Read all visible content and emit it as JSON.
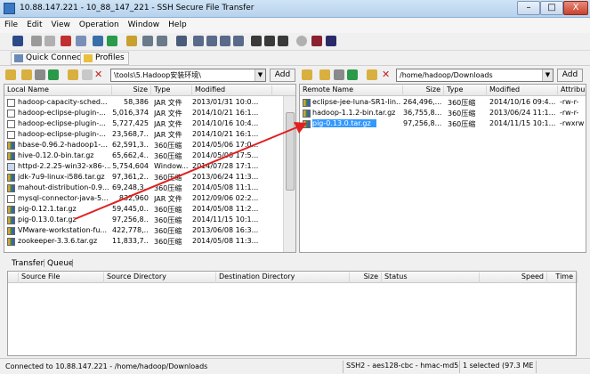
{
  "window": {
    "title": "10.88.147.221 - 10_88_147_221 - SSH Secure File Transfer",
    "minimize": "–",
    "maximize": "□",
    "close": "X"
  },
  "menu": [
    "File",
    "Edit",
    "View",
    "Operation",
    "Window",
    "Help"
  ],
  "toolbar2": {
    "quick_connect": "Quick Connect",
    "profiles": "Profiles"
  },
  "local": {
    "path": "\\tools\\5.Hadoop安装环境\\",
    "add": "Add",
    "columns": [
      "Local Name",
      "Size",
      "Type",
      "Modified"
    ],
    "files": [
      {
        "name": "hadoop-capacity-sched...",
        "size": "58,386",
        "type": "JAR 文件",
        "modified": "2013/01/31 10:0...",
        "icon": "plain"
      },
      {
        "name": "hadoop-eclipse-plugin-...",
        "size": "5,016,374",
        "type": "JAR 文件",
        "modified": "2014/10/21 16:1...",
        "icon": "plain"
      },
      {
        "name": "hadoop-eclipse-plugin-...",
        "size": "5,727,425",
        "type": "JAR 文件",
        "modified": "2014/10/16 10:4...",
        "icon": "plain"
      },
      {
        "name": "hadoop-eclipse-plugin-...",
        "size": "23,568,7...",
        "type": "JAR 文件",
        "modified": "2014/10/21 16:1...",
        "icon": "plain"
      },
      {
        "name": "hbase-0.96.2-hadoop1-...",
        "size": "62,591,3...",
        "type": "360压缩",
        "modified": "2014/05/06 17:0...",
        "icon": "zip"
      },
      {
        "name": "hive-0.12.0-bin.tar.gz",
        "size": "65,662,4...",
        "type": "360压缩",
        "modified": "2014/05/06 17:5...",
        "icon": "zip"
      },
      {
        "name": "httpd-2.2.25-win32-x86-...",
        "size": "5,754,604",
        "type": "Window...",
        "modified": "2014/07/28 17:1...",
        "icon": "exe"
      },
      {
        "name": "jdk-7u9-linux-i586.tar.gz",
        "size": "97,361,2...",
        "type": "360压缩",
        "modified": "2013/06/24 11:3...",
        "icon": "zip"
      },
      {
        "name": "mahout-distribution-0.9...",
        "size": "69,248,3...",
        "type": "360压缩",
        "modified": "2014/05/08 11:1...",
        "icon": "zip"
      },
      {
        "name": "mysql-connector-java-5...",
        "size": "832,960",
        "type": "JAR 文件",
        "modified": "2012/09/06 02:2...",
        "icon": "plain"
      },
      {
        "name": "pig-0.12.1.tar.gz",
        "size": "59,445,0...",
        "type": "360压缩",
        "modified": "2014/05/08 11:2...",
        "icon": "zip"
      },
      {
        "name": "pig-0.13.0.tar.gz",
        "size": "97,256,8...",
        "type": "360压缩",
        "modified": "2014/11/15 10:1...",
        "icon": "zip"
      },
      {
        "name": "VMware-workstation-fu...",
        "size": "422,778,...",
        "type": "360压缩",
        "modified": "2013/06/08 16:3...",
        "icon": "zip"
      },
      {
        "name": "zookeeper-3.3.6.tar.gz",
        "size": "11,833,7...",
        "type": "360压缩",
        "modified": "2014/05/08 11:3...",
        "icon": "zip"
      }
    ]
  },
  "remote": {
    "path": "/home/hadoop/Downloads",
    "add": "Add",
    "columns": [
      "Remote Name",
      "Size",
      "Type",
      "Modified",
      "Attribu"
    ],
    "files": [
      {
        "name": "eclipse-jee-luna-SR1-lin...",
        "size": "264,496,...",
        "type": "360压缩",
        "modified": "2014/10/16 09:4...",
        "attr": "-rw-r-"
      },
      {
        "name": "hadoop-1.1.2-bin.tar.gz",
        "size": "36,755,8...",
        "type": "360压缩",
        "modified": "2013/06/24 11:1...",
        "attr": "-rw-r-"
      },
      {
        "name": "pig-0.13.0.tar.gz",
        "size": "97,256,8...",
        "type": "360压缩",
        "modified": "2014/11/15 10:1...",
        "attr": "-rwxrw"
      }
    ]
  },
  "queue": {
    "tabs": [
      "Transfer",
      "Queue"
    ],
    "columns": [
      "Source File",
      "Source Directory",
      "Destination Directory",
      "Size",
      "Status",
      "Speed",
      "Time"
    ]
  },
  "status": {
    "connection": "Connected to 10.88.147.221 - /home/hadoop/Downloads",
    "protocol": "SSH2 - aes128-cbc - hmac-md5",
    "selection": "1 selected (97.3 ME"
  },
  "colors": {
    "selection": "#3399ff",
    "arrow": "#e02020"
  }
}
